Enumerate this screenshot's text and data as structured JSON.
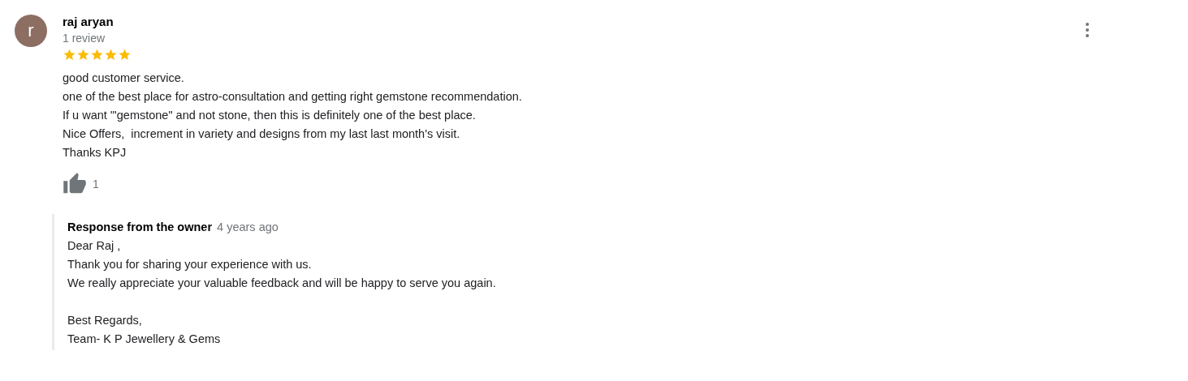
{
  "review": {
    "avatar_letter": "r",
    "author": "raj aryan",
    "review_count": "1 review",
    "stars": 5,
    "lines": [
      "good customer service.",
      "one of the best place for astro-consultation and getting right gemstone recommendation.",
      "If u want '\"gemstone\" and not stone, then this is definitely one of the best place.",
      "Nice Offers,  increment in variety and designs from my last last month's visit.",
      "Thanks KPJ"
    ],
    "likes": "1"
  },
  "owner_response": {
    "title": "Response from the owner",
    "time": "4 years ago",
    "paragraphs": [
      [
        "Dear Raj ,",
        "Thank you for sharing your experience with us.",
        "We really appreciate your valuable feedback and will be happy to serve you again."
      ],
      [
        "Best Regards,",
        "Team- K P Jewellery & Gems"
      ]
    ]
  }
}
